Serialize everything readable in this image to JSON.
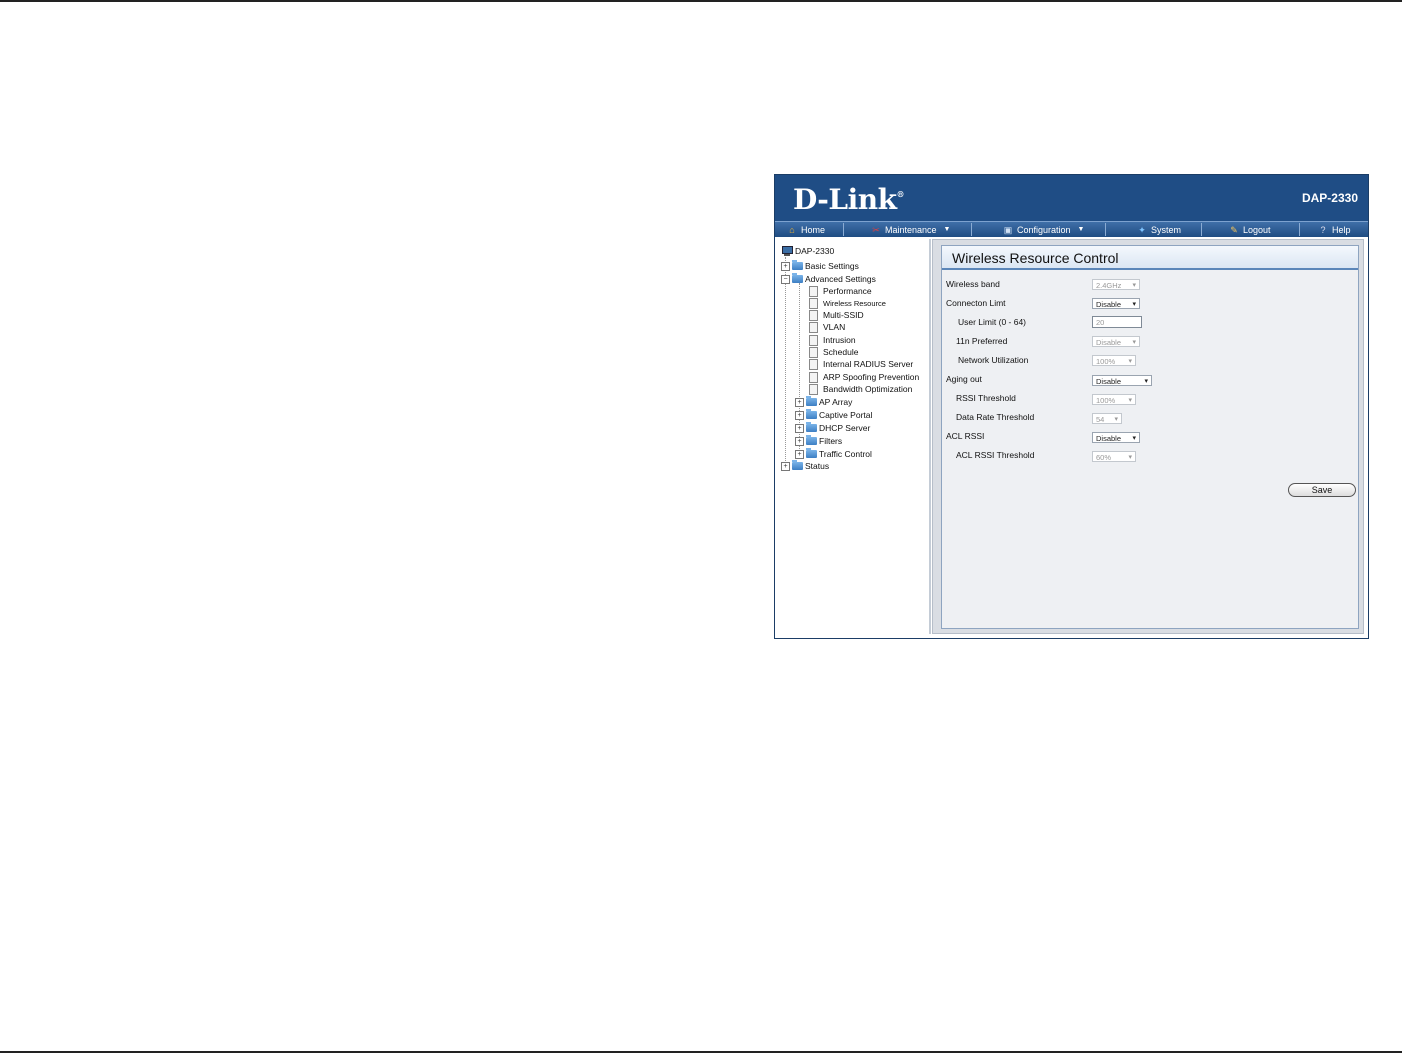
{
  "brand": "D-Link",
  "model": "DAP-2330",
  "menu": [
    {
      "label": "Home",
      "icon": "home-icon",
      "dropdown": false
    },
    {
      "label": "Maintenance",
      "icon": "tools-icon",
      "dropdown": true
    },
    {
      "label": "Configuration",
      "icon": "disk-icon",
      "dropdown": true
    },
    {
      "label": "System",
      "icon": "system-icon",
      "dropdown": false
    },
    {
      "label": "Logout",
      "icon": "logout-icon",
      "dropdown": false
    },
    {
      "label": "Help",
      "icon": "help-icon",
      "dropdown": false
    }
  ],
  "tree": {
    "root": "DAP-2330",
    "basic": "Basic Settings",
    "advanced": "Advanced Settings",
    "advanced_items": [
      "Performance",
      "Wireless Resource",
      "Multi-SSID",
      "VLAN",
      "Intrusion",
      "Schedule",
      "Internal RADIUS Server",
      "ARP Spoofing Prevention",
      "Bandwidth Optimization"
    ],
    "advanced_folders": [
      "AP Array",
      "Captive Portal",
      "DHCP Server",
      "Filters",
      "Traffic Control"
    ],
    "status": "Status"
  },
  "panel": {
    "title": "Wireless Resource Control",
    "save_label": "Save",
    "fields": {
      "wireless_band": {
        "label": "Wireless band",
        "value": "2.4GHz"
      },
      "connection_limit": {
        "label": "Connecton Limt",
        "value": "Disable"
      },
      "user_limit": {
        "label": "User Limit (0 - 64)",
        "value": "20"
      },
      "preferred_11n": {
        "label": "11n Preferred",
        "value": "Disable"
      },
      "network_utilization": {
        "label": "Network Utilization",
        "value": "100%"
      },
      "aging_out": {
        "label": "Aging out",
        "value": "Disable"
      },
      "rssi_threshold": {
        "label": "RSSI Threshold",
        "value": "100%"
      },
      "data_rate_threshold": {
        "label": "Data Rate Threshold",
        "value": "54"
      },
      "acl_rssi": {
        "label": "ACL RSSI",
        "value": "Disable"
      },
      "acl_rssi_threshold": {
        "label": "ACL RSSI Threshold",
        "value": "60%"
      }
    }
  }
}
